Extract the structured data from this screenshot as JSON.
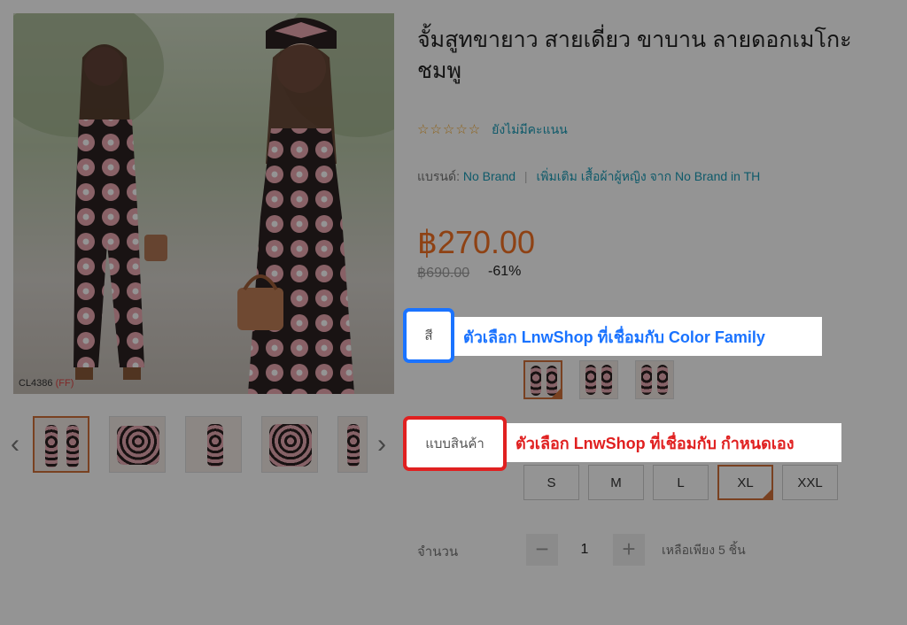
{
  "product": {
    "title": "จั้มสูทขายาว สายเดี่ยว ขาบาน ลายดอกเมโกะ ชมพู",
    "rating_text": "ยังไม่มีคะแนน",
    "stars": "☆☆☆☆☆",
    "brand_label": "แบรนด์:",
    "brand_name": "No Brand",
    "brand_more": "เพิ่มเติม เสื้อผ้าผู้หญิง จาก No Brand in TH",
    "price": "฿270.00",
    "old_price": "฿690.00",
    "discount": "-61%",
    "image_code": "CL4386",
    "image_code_tag": "(FF)"
  },
  "options": {
    "color_label": "สี",
    "color_callout": "ตัวเลือก LnwShop ที่เชื่อมกับ Color Family",
    "variant_label": "แบบสินค้า",
    "variant_callout": "ตัวเลือก LnwShop ที่เชื่อมกับ กำหนดเอง",
    "sizes": [
      "S",
      "M",
      "L",
      "XL",
      "XXL"
    ],
    "selected_size": "XL"
  },
  "quantity": {
    "label": "จำนวน",
    "value": "1",
    "minus": "−",
    "plus": "+",
    "stock_text": "เหลือเพียง 5 ชิ้น"
  },
  "gallery": {
    "prev": "‹",
    "next": "›"
  },
  "colors": {
    "price": "#f57224",
    "link": "#1a9cb7",
    "highlight_blue": "#1a73ff",
    "highlight_red": "#e02020",
    "selected_border": "#d0713a"
  }
}
